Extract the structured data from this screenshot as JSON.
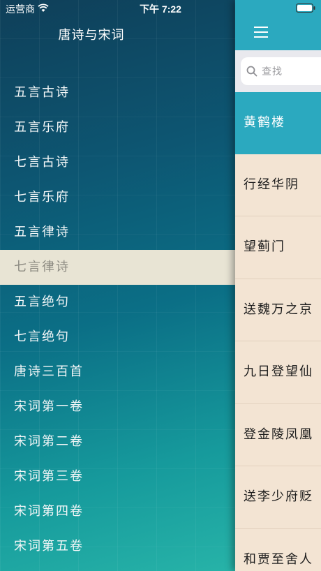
{
  "status": {
    "carrier": "运营商",
    "time": "下午 7:22"
  },
  "sidebar": {
    "title": "唐诗与宋词",
    "items": [
      {
        "label": "五言古诗",
        "selected": false
      },
      {
        "label": "五言乐府",
        "selected": false
      },
      {
        "label": "七言古诗",
        "selected": false
      },
      {
        "label": "七言乐府",
        "selected": false
      },
      {
        "label": "五言律诗",
        "selected": false
      },
      {
        "label": "七言律诗",
        "selected": true
      },
      {
        "label": "五言绝句",
        "selected": false
      },
      {
        "label": "七言绝句",
        "selected": false
      },
      {
        "label": "唐诗三百首",
        "selected": false
      },
      {
        "label": "宋词第一卷",
        "selected": false
      },
      {
        "label": "宋词第二卷",
        "selected": false
      },
      {
        "label": "宋词第三卷",
        "selected": false
      },
      {
        "label": "宋词第四卷",
        "selected": false
      },
      {
        "label": "宋词第五卷",
        "selected": false
      }
    ]
  },
  "panel": {
    "menu_icon": "hamburger-icon",
    "search": {
      "placeholder": "查找",
      "icon": "search-icon"
    },
    "poems": [
      {
        "title": "黄鹤楼",
        "selected": true
      },
      {
        "title": "行经华阴",
        "selected": false
      },
      {
        "title": "望蓟门",
        "selected": false
      },
      {
        "title": "送魏万之京",
        "selected": false
      },
      {
        "title": "九日登望仙",
        "selected": false
      },
      {
        "title": "登金陵凤凰",
        "selected": false
      },
      {
        "title": "送李少府贬",
        "selected": false
      },
      {
        "title": "和贾至舍人",
        "selected": false
      }
    ]
  },
  "colors": {
    "accent": "#2ba9bf",
    "selected_menu_bg": "#e8e4d4",
    "panel_bg": "#f3e4d3"
  }
}
